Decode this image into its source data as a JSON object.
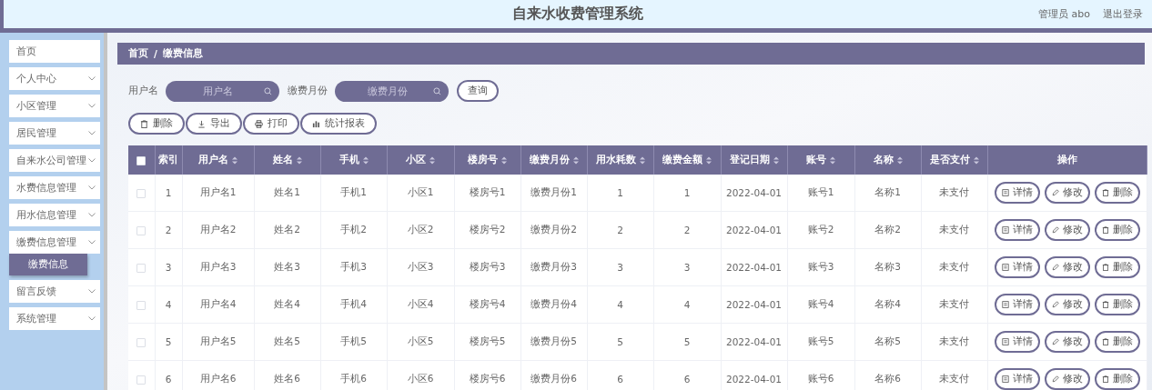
{
  "header": {
    "title": "自来水收费管理系统",
    "user": "管理员 abo",
    "logout": "退出登录"
  },
  "sidebar": {
    "items": [
      {
        "label": "首页",
        "kind": "link"
      },
      {
        "label": "个人中心",
        "kind": "menu"
      },
      {
        "label": "小区管理",
        "kind": "menu"
      },
      {
        "label": "居民管理",
        "kind": "menu"
      },
      {
        "label": "自来水公司管理",
        "kind": "menu"
      },
      {
        "label": "水费信息管理",
        "kind": "menu"
      },
      {
        "label": "用水信息管理",
        "kind": "menu"
      },
      {
        "label": "缴费信息管理",
        "kind": "menu",
        "children": [
          {
            "label": "缴费信息",
            "selected": true
          }
        ]
      },
      {
        "label": "留言反馈",
        "kind": "menu"
      },
      {
        "label": "系统管理",
        "kind": "menu"
      }
    ]
  },
  "breadcrumb": [
    "首页",
    "/",
    "缴费信息"
  ],
  "search": {
    "fields": [
      {
        "label": "用户名",
        "placeholder": "用户名"
      },
      {
        "label": "缴费月份",
        "placeholder": "缴费月份"
      }
    ],
    "button": "查询"
  },
  "toolbar": [
    {
      "label": "删除",
      "kind": "delete"
    },
    {
      "label": "导出",
      "kind": "export"
    },
    {
      "label": "打印",
      "kind": "print"
    },
    {
      "label": "统计报表",
      "kind": "chart"
    }
  ],
  "table": {
    "select_all_checked": false,
    "columns": [
      {
        "label": "索引",
        "sortable": false
      },
      {
        "label": "用户名",
        "sortable": true
      },
      {
        "label": "姓名",
        "sortable": true
      },
      {
        "label": "手机",
        "sortable": true
      },
      {
        "label": "小区",
        "sortable": true
      },
      {
        "label": "楼房号",
        "sortable": true
      },
      {
        "label": "缴费月份",
        "sortable": true
      },
      {
        "label": "用水耗数",
        "sortable": true
      },
      {
        "label": "缴费金额",
        "sortable": true
      },
      {
        "label": "登记日期",
        "sortable": true
      },
      {
        "label": "账号",
        "sortable": true
      },
      {
        "label": "名称",
        "sortable": true
      },
      {
        "label": "是否支付",
        "sortable": true
      },
      {
        "label": "操作",
        "sortable": false
      }
    ],
    "rows": [
      {
        "checked": false,
        "cells": [
          "1",
          "用户名1",
          "姓名1",
          "手机1",
          "小区1",
          "楼房号1",
          "缴费月份1",
          "1",
          "1",
          "2022-04-01",
          "账号1",
          "名称1",
          "未支付"
        ],
        "actions": [
          {
            "label": "详情",
            "kind": "detail"
          },
          {
            "label": "修改",
            "kind": "edit"
          },
          {
            "label": "删除",
            "kind": "delete"
          }
        ]
      },
      {
        "checked": false,
        "cells": [
          "2",
          "用户名2",
          "姓名2",
          "手机2",
          "小区2",
          "楼房号2",
          "缴费月份2",
          "2",
          "2",
          "2022-04-01",
          "账号2",
          "名称2",
          "未支付"
        ],
        "actions": [
          {
            "label": "详情",
            "kind": "detail"
          },
          {
            "label": "修改",
            "kind": "edit"
          },
          {
            "label": "删除",
            "kind": "delete"
          }
        ]
      },
      {
        "checked": false,
        "cells": [
          "3",
          "用户名3",
          "姓名3",
          "手机3",
          "小区3",
          "楼房号3",
          "缴费月份3",
          "3",
          "3",
          "2022-04-01",
          "账号3",
          "名称3",
          "未支付"
        ],
        "actions": [
          {
            "label": "详情",
            "kind": "detail"
          },
          {
            "label": "修改",
            "kind": "edit"
          },
          {
            "label": "删除",
            "kind": "delete"
          }
        ]
      },
      {
        "checked": false,
        "cells": [
          "4",
          "用户名4",
          "姓名4",
          "手机4",
          "小区4",
          "楼房号4",
          "缴费月份4",
          "4",
          "4",
          "2022-04-01",
          "账号4",
          "名称4",
          "未支付"
        ],
        "actions": [
          {
            "label": "详情",
            "kind": "detail"
          },
          {
            "label": "修改",
            "kind": "edit"
          },
          {
            "label": "删除",
            "kind": "delete"
          }
        ]
      },
      {
        "checked": false,
        "cells": [
          "5",
          "用户名5",
          "姓名5",
          "手机5",
          "小区5",
          "楼房号5",
          "缴费月份5",
          "5",
          "5",
          "2022-04-01",
          "账号5",
          "名称5",
          "未支付"
        ],
        "actions": [
          {
            "label": "详情",
            "kind": "detail"
          },
          {
            "label": "修改",
            "kind": "edit"
          },
          {
            "label": "删除",
            "kind": "delete"
          }
        ]
      },
      {
        "checked": false,
        "cells": [
          "6",
          "用户名6",
          "姓名6",
          "手机6",
          "小区6",
          "楼房号6",
          "缴费月份6",
          "6",
          "6",
          "2022-04-01",
          "账号6",
          "名称6",
          "未支付"
        ],
        "actions": [
          {
            "label": "详情",
            "kind": "detail"
          },
          {
            "label": "修改",
            "kind": "edit"
          },
          {
            "label": "删除",
            "kind": "delete"
          }
        ]
      }
    ]
  }
}
